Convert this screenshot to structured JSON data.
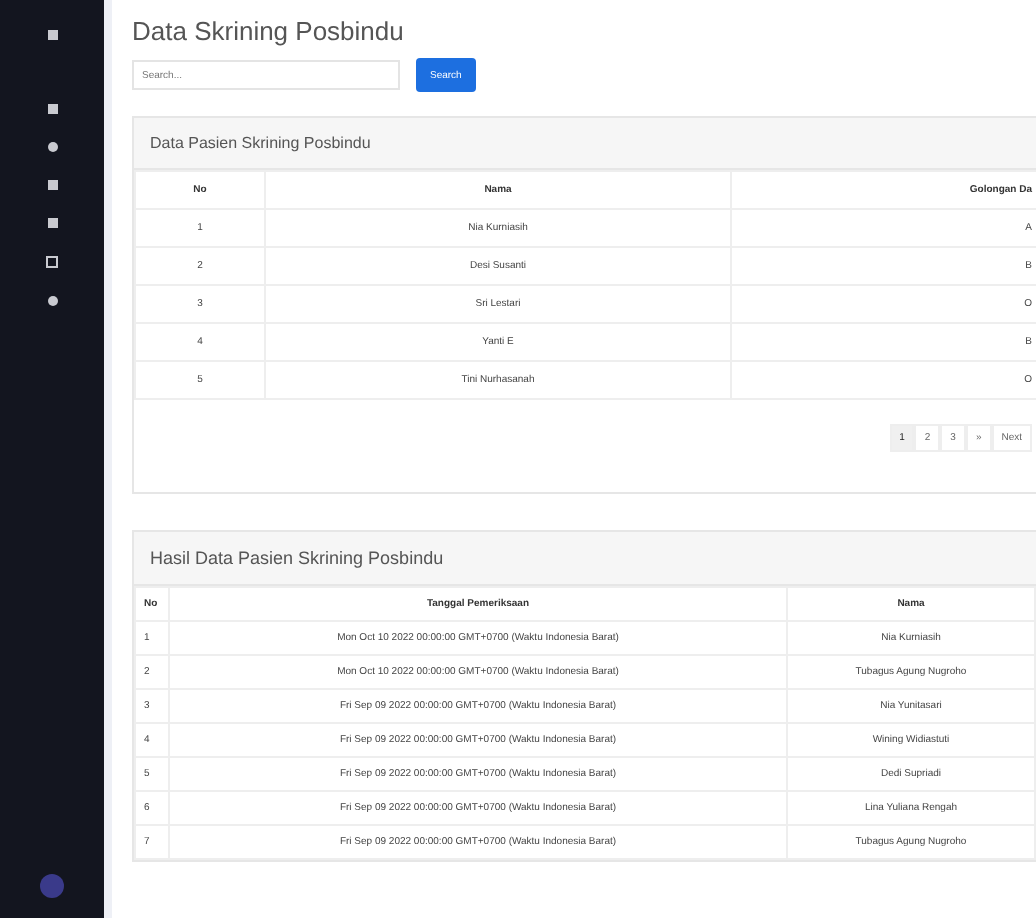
{
  "page": {
    "title": "Data Skrining Posbindu"
  },
  "search": {
    "placeholder": "Search...",
    "button": "Search"
  },
  "patients": {
    "title": "Data Pasien Skrining Posbindu",
    "columns": [
      "No",
      "Nama",
      "Golongan Da"
    ],
    "rows": [
      [
        "1",
        "Nia Kurniasih",
        "A"
      ],
      [
        "2",
        "Desi Susanti",
        "B"
      ],
      [
        "3",
        "Sri Lestari",
        "O"
      ],
      [
        "4",
        "Yanti E",
        "B"
      ],
      [
        "5",
        "Tini Nurhasanah",
        "O"
      ]
    ],
    "pagination": [
      {
        "label": "1",
        "selected": true
      },
      {
        "label": "2",
        "selected": false
      },
      {
        "label": "3",
        "selected": false
      },
      {
        "label": "»",
        "selected": false
      },
      {
        "label": "Next",
        "selected": false
      }
    ]
  },
  "results": {
    "title": "Hasil Data Pasien Skrining Posbindu",
    "columns": [
      "No",
      "Tanggal Pemeriksaan",
      "Nama"
    ],
    "rows": [
      [
        "1",
        "Mon Oct 10 2022 00:00:00 GMT+0700 (Waktu Indonesia Barat)",
        "Nia Kurniasih"
      ],
      [
        "2",
        "Mon Oct 10 2022 00:00:00 GMT+0700 (Waktu Indonesia Barat)",
        "Tubagus Agung Nugroho"
      ],
      [
        "3",
        "Fri Sep 09 2022 00:00:00 GMT+0700 (Waktu Indonesia Barat)",
        "Nia Yunitasari"
      ],
      [
        "4",
        "Fri Sep 09 2022 00:00:00 GMT+0700 (Waktu Indonesia Barat)",
        "Wining Widiastuti"
      ],
      [
        "5",
        "Fri Sep 09 2022 00:00:00 GMT+0700 (Waktu Indonesia Barat)",
        "Dedi Supriadi"
      ],
      [
        "6",
        "Fri Sep 09 2022 00:00:00 GMT+0700 (Waktu Indonesia Barat)",
        "Lina Yuliana Rengah"
      ],
      [
        "7",
        "Fri Sep 09 2022 00:00:00 GMT+0700 (Waktu Indonesia Barat)",
        "Tubagus Agung Nugroho"
      ]
    ]
  }
}
